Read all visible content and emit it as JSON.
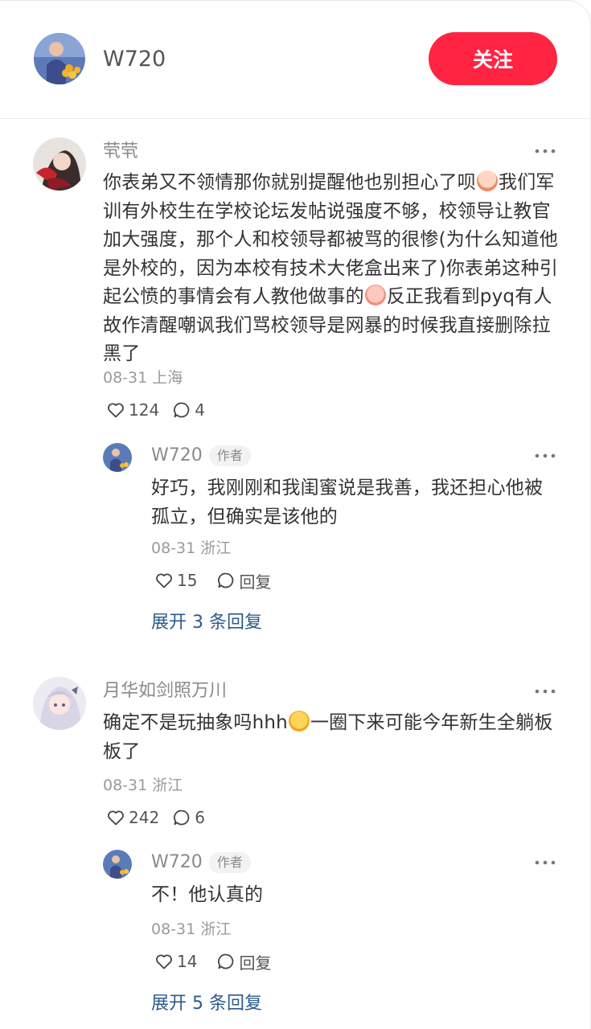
{
  "header": {
    "username": "W720",
    "follow_label": "关注"
  },
  "comments": [
    {
      "user": "茕茕",
      "text_parts": [
        "你表弟又不领情那你就别提醒他也别担心了呗",
        "我们军训有外校生在学校论坛发帖说强度不够，校领导让教官加大强度，那个人和校领导都被骂的很惨(为什么知道他是外校的，因为本校有技术大佬盒出来了)你表弟这种引起公愤的事情会有人教他做事的",
        "反正我看到pyq有人故作清醒嘲讽我们骂校领导是网暴的时候我直接删除拉黑了"
      ],
      "date_location": "08-31 上海",
      "likes": "124",
      "replies": "4",
      "reply": {
        "user": "W720",
        "tag": "作者",
        "text": "好巧，我刚刚和我闺蜜说是我善，我还担心他被孤立，但确实是该他的",
        "date_location": "08-31 浙江",
        "likes": "15",
        "reply_label": "回复"
      },
      "expand_label": "展开 3 条回复"
    },
    {
      "user": "月华如剑照万川",
      "text_parts": [
        "确定不是玩抽象吗hhh",
        "一圈下来可能今年新生全躺板板了"
      ],
      "date_location": "08-31 浙江",
      "likes": "242",
      "replies": "6",
      "reply": {
        "user": "W720",
        "tag": "作者",
        "text": "不！他认真的",
        "date_location": "08-31 浙江",
        "likes": "14",
        "reply_label": "回复"
      },
      "expand_label": "展开 5 条回复"
    }
  ],
  "icons": {
    "like": "heart-outline-icon",
    "comment": "comment-bubble-icon",
    "more": "more-dots-icon"
  },
  "colors": {
    "accent": "#ff2442",
    "link": "#2c5a8c",
    "muted": "#9a9a9a"
  }
}
